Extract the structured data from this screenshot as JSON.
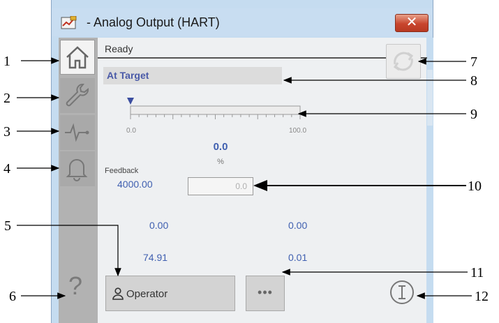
{
  "window": {
    "title": "- Analog Output (HART)",
    "close_glyph": "✕"
  },
  "status": {
    "text": "Ready"
  },
  "target": {
    "text": "At Target"
  },
  "scale": {
    "min_label": "0.0",
    "max_label": "100.0",
    "marker_value": 0.0
  },
  "process_value": {
    "value": "0.0",
    "unit": "%"
  },
  "feedback": {
    "label": "Feedback",
    "value": "4000.00"
  },
  "entry": {
    "value": "0.0"
  },
  "readouts": {
    "row1_left": "0.00",
    "row1_right": "0.00",
    "row2_left": "74.91",
    "row2_right": "0.01"
  },
  "buttons": {
    "operator_label": "Operator",
    "more_label": "•••",
    "help_label": "?"
  },
  "callouts": [
    "1",
    "2",
    "3",
    "4",
    "5",
    "6",
    "7",
    "8",
    "9",
    "10",
    "11",
    "12"
  ],
  "colors": {
    "accent_text": "#3f5fb0",
    "target_text": "#4a5aa8",
    "marker": "#3b4ea0",
    "sidebar": "#b2b2b2"
  }
}
